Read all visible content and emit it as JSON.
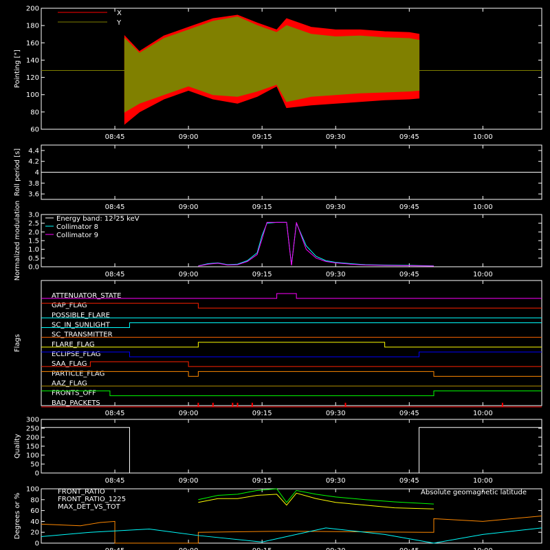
{
  "chart_data": [
    {
      "id": "pointing",
      "type": "area",
      "ylabel": "Pointing [\"]",
      "ylim": [
        60,
        200
      ],
      "yticks": [
        60,
        80,
        100,
        120,
        140,
        160,
        180,
        200
      ],
      "xrange": [
        "08:30",
        "10:12"
      ],
      "xticks": [
        "08:45",
        "09:00",
        "09:15",
        "09:30",
        "09:45",
        "10:00"
      ],
      "legend": [
        {
          "name": "X",
          "color": "#ff0000"
        },
        {
          "name": "Y",
          "color": "#808000"
        }
      ],
      "reference_line": 128,
      "data_start": "08:47",
      "data_end": "09:47",
      "series": [
        {
          "name": "X",
          "color": "#ff0000",
          "x": [
            "08:47",
            "08:50",
            "08:55",
            "09:00",
            "09:05",
            "09:10",
            "09:14",
            "09:18",
            "09:20",
            "09:25",
            "09:30",
            "09:35",
            "09:40",
            "09:45",
            "09:47"
          ],
          "upper": [
            168,
            150,
            168,
            178,
            188,
            192,
            183,
            175,
            188,
            178,
            175,
            175,
            173,
            172,
            170
          ],
          "lower": [
            66,
            80,
            95,
            105,
            95,
            90,
            98,
            110,
            85,
            88,
            90,
            92,
            94,
            95,
            96
          ]
        },
        {
          "name": "Y",
          "color": "#808000",
          "x": [
            "08:47",
            "08:50",
            "08:55",
            "09:00",
            "09:05",
            "09:10",
            "09:14",
            "09:18",
            "09:20",
            "09:25",
            "09:30",
            "09:35",
            "09:40",
            "09:45",
            "09:47"
          ],
          "upper": [
            165,
            148,
            165,
            175,
            185,
            190,
            180,
            172,
            180,
            170,
            167,
            168,
            166,
            165,
            163
          ],
          "lower": [
            80,
            90,
            100,
            110,
            100,
            98,
            104,
            112,
            92,
            98,
            100,
            102,
            103,
            104,
            105
          ]
        }
      ]
    },
    {
      "id": "roll",
      "type": "line",
      "ylabel": "Roll period [s]",
      "ylim": [
        3.5,
        4.5
      ],
      "yticks": [
        3.6,
        3.8,
        4.0,
        4.2,
        4.4
      ],
      "xticks": [
        "08:45",
        "09:00",
        "09:15",
        "09:30",
        "09:45",
        "10:00"
      ],
      "series": [
        {
          "name": "Roll period",
          "x": [
            "08:30",
            "10:12"
          ],
          "y": [
            4.0,
            4.0
          ]
        }
      ]
    },
    {
      "id": "modulation",
      "type": "line",
      "ylabel": "Normalized modulation",
      "ylim": [
        0,
        3.0
      ],
      "yticks": [
        "0.0",
        "0.5",
        "1.0",
        "1.5",
        "2.0",
        "2.5",
        "3.0"
      ],
      "xticks": [
        "08:45",
        "09:00",
        "09:15",
        "09:30",
        "09:45",
        "10:00"
      ],
      "legend_title": "Energy band: 12-25 keV",
      "series": [
        {
          "name": "Collimator 8",
          "color": "#00ffff",
          "x": [
            "09:02",
            "09:04",
            "09:06",
            "09:08",
            "09:10",
            "09:12",
            "09:14",
            "09:15",
            "09:16",
            "09:18",
            "09:20",
            "09:21",
            "09:22",
            "09:24",
            "09:26",
            "09:28",
            "09:30",
            "09:33",
            "09:36",
            "09:40",
            "09:45",
            "09:50"
          ],
          "y": [
            0.05,
            0.18,
            0.22,
            0.12,
            0.15,
            0.35,
            0.8,
            1.8,
            2.5,
            2.55,
            2.55,
            0.1,
            2.5,
            1.2,
            0.6,
            0.35,
            0.25,
            0.18,
            0.12,
            0.1,
            0.08,
            0.05
          ]
        },
        {
          "name": "Collimator 9",
          "color": "#ff00ff",
          "x": [
            "09:02",
            "09:04",
            "09:06",
            "09:08",
            "09:10",
            "09:12",
            "09:14",
            "09:15",
            "09:16",
            "09:18",
            "09:20",
            "09:21",
            "09:22",
            "09:24",
            "09:26",
            "09:28",
            "09:30",
            "09:33",
            "09:36",
            "09:40",
            "09:45",
            "09:50"
          ],
          "y": [
            0.04,
            0.15,
            0.2,
            0.1,
            0.12,
            0.3,
            0.7,
            1.6,
            2.55,
            2.55,
            2.55,
            0.08,
            2.55,
            1.0,
            0.5,
            0.3,
            0.22,
            0.15,
            0.1,
            0.08,
            0.06,
            0.04
          ]
        }
      ]
    },
    {
      "id": "flags",
      "type": "line",
      "ylabel": "Flags",
      "xticks": [
        "08:45",
        "09:00",
        "09:15",
        "09:30",
        "09:45",
        "10:00"
      ],
      "series": [
        {
          "name": "ATTENUATOR_STATE",
          "color": "#ff00ff",
          "steps": [
            [
              "08:30",
              0
            ],
            [
              "09:18",
              1
            ],
            [
              "09:22",
              0
            ]
          ]
        },
        {
          "name": "GAP_FLAG",
          "color": "#ff2200",
          "steps": [
            [
              "08:30",
              1
            ],
            [
              "09:02",
              0
            ]
          ]
        },
        {
          "name": "POSSIBLE_FLARE",
          "color": "#00ffff",
          "steps": [
            [
              "08:30",
              0
            ]
          ]
        },
        {
          "name": "SC_IN_SUNLIGHT",
          "color": "#00ffff",
          "steps": [
            [
              "08:30",
              0
            ],
            [
              "08:48",
              1
            ]
          ]
        },
        {
          "name": "SC_TRANSMITTER",
          "color": "#ff6600",
          "steps": [
            [
              "08:30",
              0
            ]
          ]
        },
        {
          "name": "FLARE_FLAG",
          "color": "#ffff00",
          "steps": [
            [
              "08:30",
              0
            ],
            [
              "09:02",
              1
            ],
            [
              "09:40",
              0
            ]
          ]
        },
        {
          "name": "ECLIPSE_FLAG",
          "color": "#0000ff",
          "steps": [
            [
              "08:30",
              1
            ],
            [
              "08:48",
              0
            ],
            [
              "09:47",
              1
            ]
          ]
        },
        {
          "name": "SAA_FLAG",
          "color": "#ff2200",
          "steps": [
            [
              "08:30",
              0
            ],
            [
              "08:40",
              1
            ],
            [
              "09:00",
              0
            ]
          ]
        },
        {
          "name": "PARTICLE_FLAG",
          "color": "#ff8800",
          "steps": [
            [
              "08:30",
              1
            ],
            [
              "09:00",
              0
            ],
            [
              "09:02",
              1
            ],
            [
              "09:50",
              0
            ]
          ]
        },
        {
          "name": "AAZ_FLAG",
          "color": "#aa8800",
          "steps": [
            [
              "08:30",
              0
            ]
          ]
        },
        {
          "name": "FRONTS_OFF",
          "color": "#00ff00",
          "steps": [
            [
              "08:30",
              1
            ],
            [
              "08:44",
              0
            ],
            [
              "09:50",
              1
            ]
          ]
        },
        {
          "name": "BAD_PACKETS",
          "color": "#ff0000",
          "spikes": [
            "09:02",
            "09:05",
            "09:09",
            "09:10",
            "09:13",
            "09:32",
            "10:04"
          ]
        }
      ]
    },
    {
      "id": "quality",
      "type": "line",
      "ylabel": "Quality",
      "ylim": [
        0,
        300
      ],
      "yticks": [
        0,
        50,
        100,
        150,
        200,
        250,
        300
      ],
      "xticks": [
        "08:45",
        "09:00",
        "09:15",
        "09:30",
        "09:45",
        "10:00"
      ],
      "series": [
        {
          "name": "Quality",
          "steps": [
            [
              "08:30",
              255
            ],
            [
              "08:48",
              0
            ],
            [
              "09:47",
              255
            ],
            [
              "10:12",
              255
            ]
          ]
        }
      ]
    },
    {
      "id": "ratios",
      "type": "line",
      "ylabel": "Degrees or %",
      "ylim": [
        0,
        100
      ],
      "yticks": [
        0,
        20,
        40,
        60,
        80,
        100
      ],
      "xticks": [
        "08:45",
        "09:00",
        "09:15",
        "09:30",
        "09:45",
        "10:00"
      ],
      "series": [
        {
          "name": "FRONT_RATIO",
          "color": "#ffff00",
          "x": [
            "09:02",
            "09:06",
            "09:10",
            "09:14",
            "09:18",
            "09:20",
            "09:22",
            "09:26",
            "09:30",
            "09:36",
            "09:42",
            "09:50"
          ],
          "y": [
            75,
            82,
            82,
            88,
            90,
            70,
            92,
            82,
            75,
            70,
            65,
            63
          ]
        },
        {
          "name": "FRONT_RATIO_1225",
          "color": "#00ff00",
          "x": [
            "09:02",
            "09:06",
            "09:10",
            "09:14",
            "09:18",
            "09:20",
            "09:22",
            "09:26",
            "09:30",
            "09:36",
            "09:42",
            "09:50"
          ],
          "y": [
            80,
            88,
            90,
            97,
            100,
            75,
            97,
            90,
            85,
            80,
            76,
            72
          ]
        },
        {
          "name": "MAX_DET_VS_TOT",
          "color": "#ff8800",
          "x": [
            "08:30",
            "08:38",
            "08:42",
            "08:45",
            "08:45",
            "09:02",
            "09:02",
            "09:20",
            "09:48",
            "09:50",
            "09:50",
            "10:00",
            "10:12"
          ],
          "y": [
            35,
            32,
            38,
            40,
            0,
            0,
            20,
            22,
            20,
            20,
            45,
            40,
            50
          ]
        },
        {
          "name": "Absolute geomagnetic latitude",
          "color": "#00ffff",
          "x": [
            "08:30",
            "08:40",
            "08:52",
            "09:02",
            "09:15",
            "09:28",
            "09:40",
            "09:50",
            "10:00",
            "10:12"
          ],
          "y": [
            12,
            20,
            26,
            14,
            2,
            28,
            16,
            0,
            16,
            28
          ]
        }
      ]
    }
  ]
}
